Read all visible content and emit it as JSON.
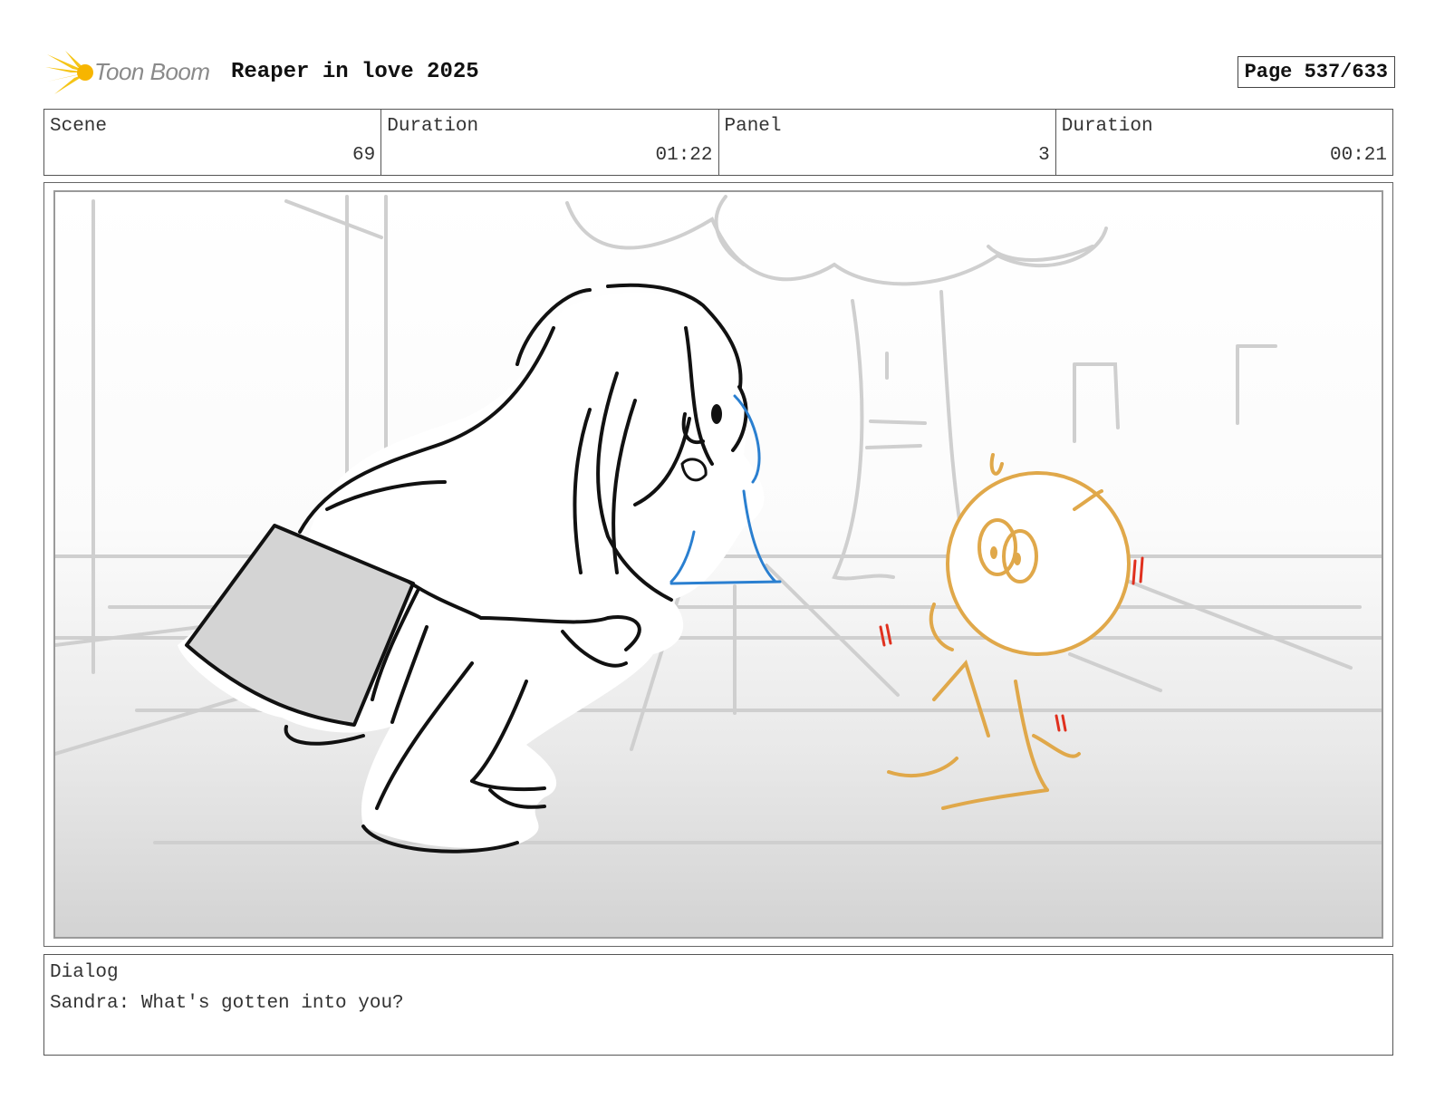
{
  "header": {
    "logo_text": "Toon Boom",
    "project_title": "Reaper in love 2025",
    "page_label": "Page 537/633"
  },
  "info": {
    "scene_label": "Scene",
    "scene_value": "69",
    "scene_duration_label": "Duration",
    "scene_duration_value": "01:22",
    "panel_label": "Panel",
    "panel_value": "3",
    "panel_duration_label": "Duration",
    "panel_duration_value": "00:21"
  },
  "dialog": {
    "label": "Dialog",
    "text": "Sandra: What's gotten into you?"
  },
  "colors": {
    "logo_yellow": "#f5c518",
    "character_orange": "#e0a84a",
    "tear_blue": "#2a7fd0",
    "shock_red": "#e0301e"
  }
}
